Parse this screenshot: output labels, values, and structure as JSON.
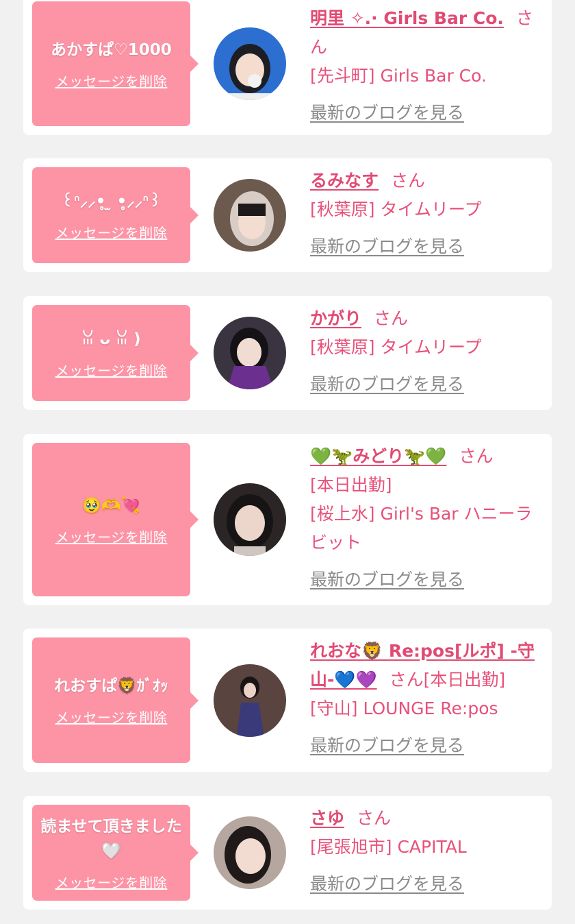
{
  "colors": {
    "bubble": "#fd94a6",
    "accent": "#e8507a",
    "link_gray": "#8a8a8a",
    "background": "#f1f1f1",
    "card": "#ffffff"
  },
  "common": {
    "delete_label": "メッセージを削除",
    "blog_label": "最新のブログを見る",
    "honorific": "さん"
  },
  "entries": [
    {
      "message": "あかすぱ♡1000",
      "name": "明里 ✧.· Girls Bar Co.",
      "lines": [
        "[先斗町] Girls Bar Co."
      ]
    },
    {
      "message": "꒰ᐢ⸝⸝•̥ ̫ •̥⸝⸝ᐢ꒱",
      "name": "るみなす",
      "lines": [
        "[秋葉原] タイムリープ"
      ]
    },
    {
      "message": "ꈍ ᴗ ꈍ )",
      "name": "かがり",
      "lines": [
        "[秋葉原] タイムリープ"
      ]
    },
    {
      "message": "🥹🫶💘",
      "name": "💚🦖みどり🦖💚",
      "lines": [
        "[本日出勤]",
        "[桜上水] Girl's Bar ハニーラビット"
      ]
    },
    {
      "message": "れおすぱ🦁ｶﾞｵｯ",
      "name": "れおな🦁 Re:pos[ルポ] -守山-💙💜",
      "suffix": "[本日出勤]",
      "lines": [
        "[守山] LOUNGE Re:pos"
      ]
    },
    {
      "message": "読ませて頂きました🤍",
      "name": "さゆ",
      "lines": [
        "[尾張旭市] CAPITAL"
      ]
    }
  ]
}
